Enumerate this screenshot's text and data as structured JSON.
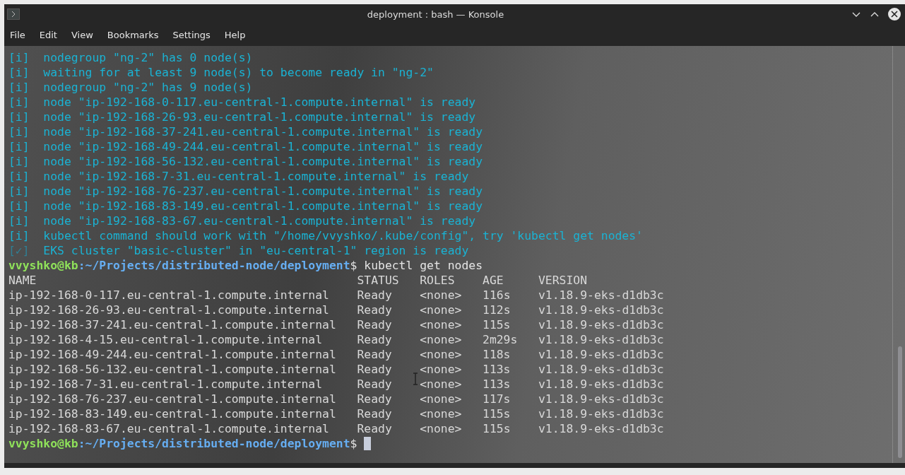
{
  "window": {
    "title": "deployment : bash — Konsole"
  },
  "menu": [
    "File",
    "Edit",
    "View",
    "Bookmarks",
    "Settings",
    "Help"
  ],
  "terminal": {
    "log": [
      {
        "kind": "info",
        "prefix": "[i]",
        "text": "nodegroup \"ng-2\" has 0 node(s)"
      },
      {
        "kind": "info",
        "prefix": "[i]",
        "text": "waiting for at least 9 node(s) to become ready in \"ng-2\""
      },
      {
        "kind": "info",
        "prefix": "[i]",
        "text": "nodegroup \"ng-2\" has 9 node(s)"
      },
      {
        "kind": "info",
        "prefix": "[i]",
        "text": "node \"ip-192-168-0-117.eu-central-1.compute.internal\" is ready"
      },
      {
        "kind": "info",
        "prefix": "[i]",
        "text": "node \"ip-192-168-26-93.eu-central-1.compute.internal\" is ready"
      },
      {
        "kind": "info",
        "prefix": "[i]",
        "text": "node \"ip-192-168-37-241.eu-central-1.compute.internal\" is ready"
      },
      {
        "kind": "info",
        "prefix": "[i]",
        "text": "node \"ip-192-168-49-244.eu-central-1.compute.internal\" is ready"
      },
      {
        "kind": "info",
        "prefix": "[i]",
        "text": "node \"ip-192-168-56-132.eu-central-1.compute.internal\" is ready"
      },
      {
        "kind": "info",
        "prefix": "[i]",
        "text": "node \"ip-192-168-7-31.eu-central-1.compute.internal\" is ready"
      },
      {
        "kind": "info",
        "prefix": "[i]",
        "text": "node \"ip-192-168-76-237.eu-central-1.compute.internal\" is ready"
      },
      {
        "kind": "info",
        "prefix": "[i]",
        "text": "node \"ip-192-168-83-149.eu-central-1.compute.internal\" is ready"
      },
      {
        "kind": "info",
        "prefix": "[i]",
        "text": "node \"ip-192-168-83-67.eu-central-1.compute.internal\" is ready"
      },
      {
        "kind": "info",
        "prefix": "[i]",
        "text": "kubectl command should work with \"/home/vvyshko/.kube/config\", try 'kubectl get nodes'"
      },
      {
        "kind": "success",
        "prefix": "[✓]",
        "text": "EKS cluster \"basic-cluster\" in \"eu-central-1\" region is ready"
      }
    ],
    "prompt": {
      "user": "vvyshko@kb",
      "path": ":~/Projects/distributed-node/deployment",
      "symbol": "$",
      "command": "kubectl get nodes"
    },
    "table": {
      "columns": [
        "NAME",
        "STATUS",
        "ROLES",
        "AGE",
        "VERSION"
      ],
      "rows": [
        [
          "ip-192-168-0-117.eu-central-1.compute.internal",
          "Ready",
          "<none>",
          "116s",
          "v1.18.9-eks-d1db3c"
        ],
        [
          "ip-192-168-26-93.eu-central-1.compute.internal",
          "Ready",
          "<none>",
          "112s",
          "v1.18.9-eks-d1db3c"
        ],
        [
          "ip-192-168-37-241.eu-central-1.compute.internal",
          "Ready",
          "<none>",
          "115s",
          "v1.18.9-eks-d1db3c"
        ],
        [
          "ip-192-168-4-15.eu-central-1.compute.internal",
          "Ready",
          "<none>",
          "2m29s",
          "v1.18.9-eks-d1db3c"
        ],
        [
          "ip-192-168-49-244.eu-central-1.compute.internal",
          "Ready",
          "<none>",
          "118s",
          "v1.18.9-eks-d1db3c"
        ],
        [
          "ip-192-168-56-132.eu-central-1.compute.internal",
          "Ready",
          "<none>",
          "113s",
          "v1.18.9-eks-d1db3c"
        ],
        [
          "ip-192-168-7-31.eu-central-1.compute.internal",
          "Ready",
          "<none>",
          "113s",
          "v1.18.9-eks-d1db3c"
        ],
        [
          "ip-192-168-76-237.eu-central-1.compute.internal",
          "Ready",
          "<none>",
          "117s",
          "v1.18.9-eks-d1db3c"
        ],
        [
          "ip-192-168-83-149.eu-central-1.compute.internal",
          "Ready",
          "<none>",
          "115s",
          "v1.18.9-eks-d1db3c"
        ],
        [
          "ip-192-168-83-67.eu-central-1.compute.internal",
          "Ready",
          "<none>",
          "115s",
          "v1.18.9-eks-d1db3c"
        ]
      ]
    },
    "final_prompt": {
      "user": "vvyshko@kb",
      "path": ":~/Projects/distributed-node/deployment",
      "symbol": "$"
    }
  }
}
